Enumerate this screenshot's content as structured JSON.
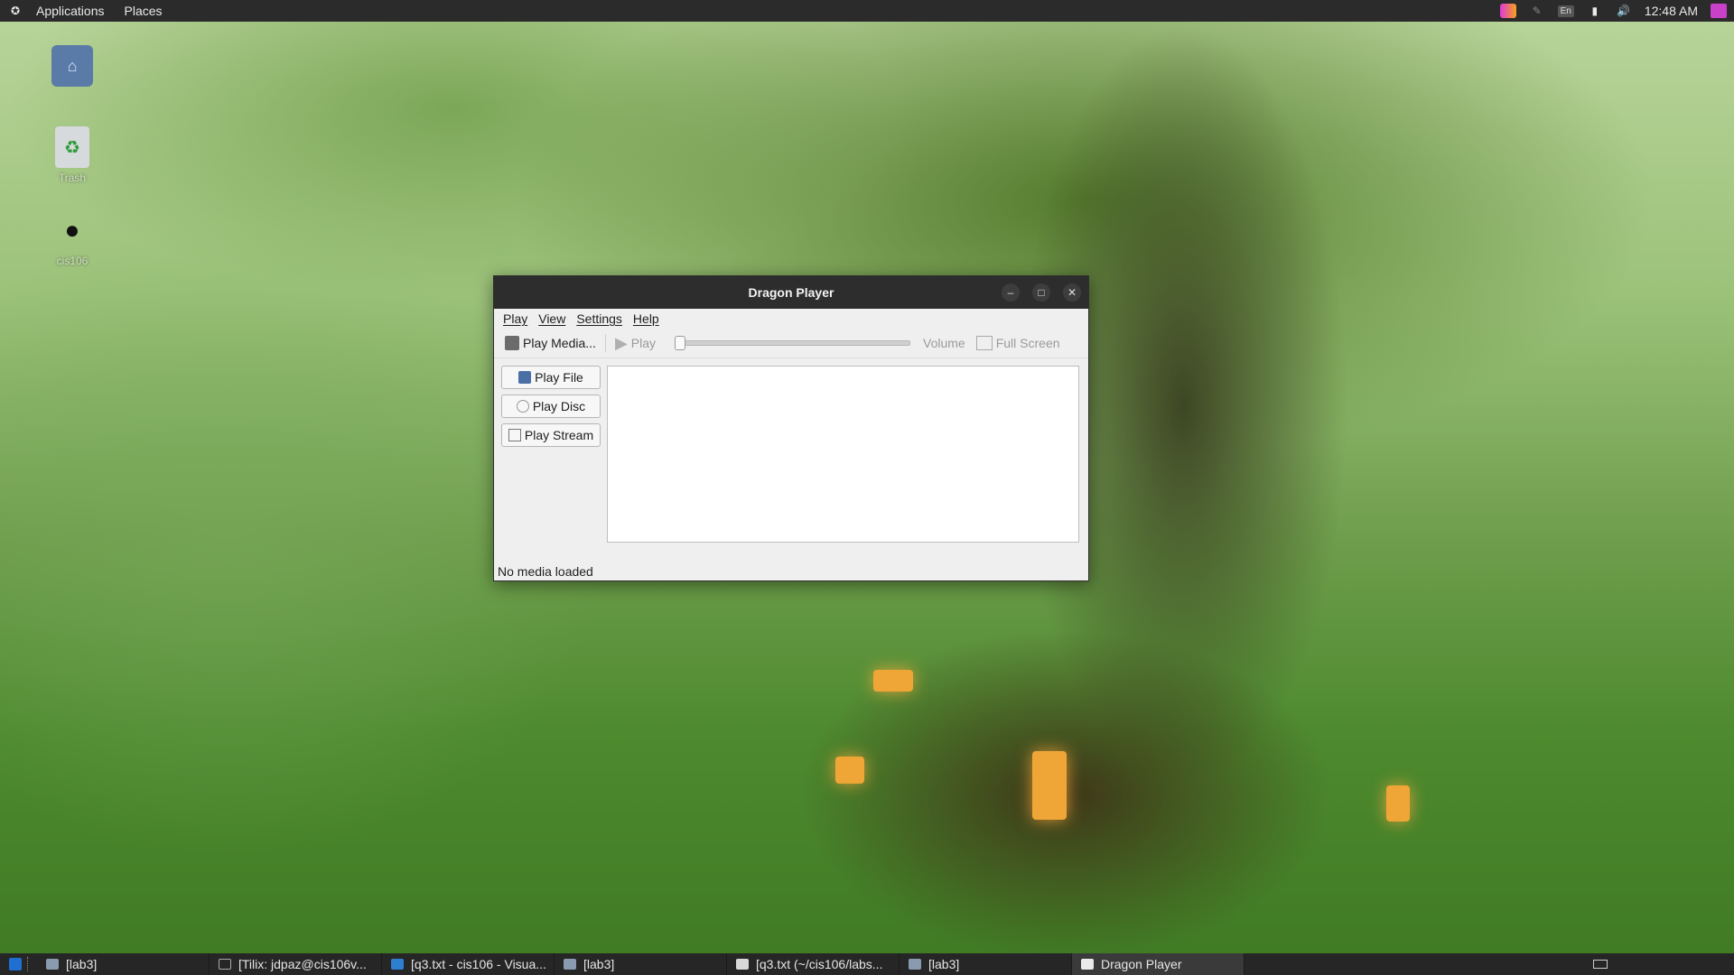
{
  "top_panel": {
    "applications_label": "Applications",
    "places_label": "Places",
    "keyboard_layout": "En",
    "clock": "12:48 AM"
  },
  "desktop_icons": [
    {
      "name": "home-folder",
      "label": ""
    },
    {
      "name": "trash",
      "label": "Trash"
    },
    {
      "name": "cis106",
      "label": "cis106"
    }
  ],
  "window": {
    "title": "Dragon Player",
    "menu": [
      "Play",
      "View",
      "Settings",
      "Help"
    ],
    "toolbar": {
      "play_media_label": "Play Media...",
      "play_label": "Play",
      "volume_label": "Volume",
      "fullscreen_label": "Full Screen",
      "position": 0
    },
    "side_buttons": [
      "Play File",
      "Play Disc",
      "Play Stream"
    ],
    "status": "No media loaded"
  },
  "taskbar": {
    "tasks": [
      {
        "label": "[lab3]",
        "icon": "folder-icon",
        "active": false
      },
      {
        "label": "[Tilix: jdpaz@cis106v...",
        "icon": "terminal-icon",
        "active": false
      },
      {
        "label": "[q3.txt - cis106 - Visua...",
        "icon": "vscode-icon",
        "active": false
      },
      {
        "label": "[lab3]",
        "icon": "folder-icon",
        "active": false
      },
      {
        "label": "[q3.txt (~/cis106/labs...",
        "icon": "text-editor-icon",
        "active": false
      },
      {
        "label": "[lab3]",
        "icon": "folder-icon",
        "active": false
      },
      {
        "label": "Dragon Player",
        "icon": "dragon-player-icon",
        "active": true
      }
    ]
  },
  "colors": {
    "panel_bg": "#2b2b2b",
    "window_bg": "#efefef",
    "titlebar_bg": "#2d2d2d",
    "accent_blue": "#1f6fd1"
  }
}
